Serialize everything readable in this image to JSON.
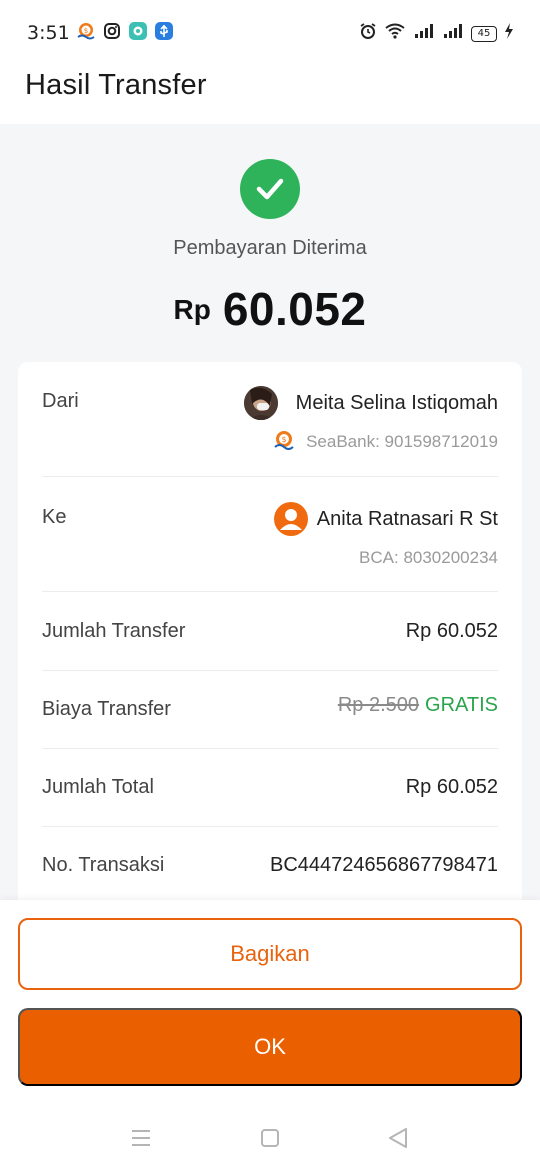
{
  "status_bar": {
    "time": "3:51",
    "battery": "45",
    "icons": [
      "seabank-icon",
      "instagram-icon",
      "chat-app-icon",
      "usb-icon",
      "alarm-icon",
      "wifi-icon",
      "signal-icon",
      "signal-icon",
      "battery-icon",
      "charging-icon"
    ]
  },
  "header": {
    "title": "Hasil Transfer"
  },
  "result": {
    "status": "Pembayaran Diterima",
    "currency": "Rp",
    "amount": "60.052",
    "success_color": "#2fb35a"
  },
  "details": {
    "from": {
      "label": "Dari",
      "name": "Meita Selina Istiqomah",
      "account": "SeaBank: 901598712019"
    },
    "to": {
      "label": "Ke",
      "name": "Anita Ratnasari R St",
      "account": "BCA: 8030200234"
    },
    "transfer_amount": {
      "label": "Jumlah Transfer",
      "value": "Rp 60.052"
    },
    "fee": {
      "label": "Biaya Transfer",
      "original": "Rp 2.500",
      "free": "GRATIS"
    },
    "total": {
      "label": "Jumlah Total",
      "value": "Rp 60.052"
    },
    "transaction_no": {
      "label": "No. Transaksi",
      "value": "BC444724656867798471"
    }
  },
  "actions": {
    "share_label": "Bagikan",
    "ok_label": "OK",
    "accent_color": "#ea6000"
  },
  "navbar": {
    "icons": [
      "menu-icon",
      "home-square-icon",
      "back-triangle-icon"
    ]
  }
}
